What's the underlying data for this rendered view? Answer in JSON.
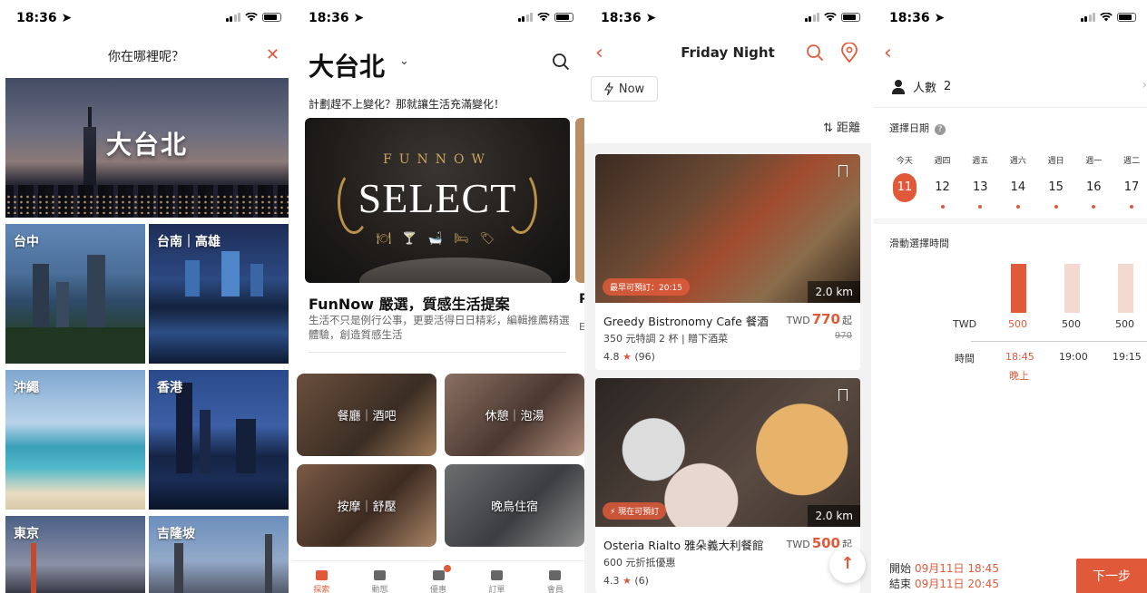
{
  "status": {
    "time": "18:36 ➤"
  },
  "screen1": {
    "title": "你在哪裡呢？",
    "close": "✕",
    "main_city": "大台北",
    "cities": [
      "台中",
      "台南｜高雄",
      "沖繩",
      "香港",
      "東京",
      "吉隆坡"
    ]
  },
  "screen2": {
    "city": "大台北",
    "chevron": "⌄",
    "tagline": "計劃趕不上變化？那就讓生活充滿變化！",
    "banner": {
      "arc": "FUNNOW",
      "title": "SELECT",
      "icons": "🍽 🍸 🛁 🛏 🏷"
    },
    "heading": "FunNow 嚴選，質感生活提案",
    "desc": "生活不只是例行公事，更要活得日日精彩，編輯推薦精選體驗，創造質感生活",
    "peek_heading": "P",
    "peek_desc": "E",
    "categories": [
      "餐廳｜酒吧",
      "休憩｜泡湯",
      "按摩｜舒壓",
      "晚鳥住宿"
    ],
    "tabs": [
      "探索",
      "動態",
      "優惠",
      "訂單",
      "會員"
    ]
  },
  "screen3": {
    "back": "‹",
    "title": "Friday Night",
    "now_chip": "Now",
    "sort": "⇅ 距離",
    "cards": [
      {
        "name": "Greedy Bistronomy Cafe 餐酒",
        "currency": "TWD",
        "price": "770",
        "price_suffix": "起",
        "desc": "350 元特調 2 杯 | 贈下酒菜",
        "original": "970",
        "rating": "4.8",
        "reviews": "(96)",
        "distance": "2.0 km",
        "badge": "最早可預訂：20:15"
      },
      {
        "name": "Osteria Rialto 雅朵義大利餐館",
        "currency": "TWD",
        "price": "500",
        "price_suffix": "起",
        "desc": "600 元折抵優惠",
        "original": "",
        "rating": "4.3",
        "reviews": "(6)",
        "distance": "2.0 km",
        "badge": "⚡ 現在可預訂"
      }
    ],
    "fab": "↑"
  },
  "screen4": {
    "back": "‹",
    "people_label": "人數",
    "people_count": "2",
    "arrow": "›",
    "date_label": "選擇日期",
    "help": "?",
    "days": [
      {
        "wd": "今天",
        "dn": "11"
      },
      {
        "wd": "週四",
        "dn": "12"
      },
      {
        "wd": "週五",
        "dn": "13"
      },
      {
        "wd": "週六",
        "dn": "14"
      },
      {
        "wd": "週日",
        "dn": "15"
      },
      {
        "wd": "週一",
        "dn": "16"
      },
      {
        "wd": "週二",
        "dn": "17"
      }
    ],
    "time_label": "滑動選擇時間",
    "twd": "TWD",
    "prices": [
      "500",
      "500",
      "500"
    ],
    "time_row": "時間",
    "times": [
      "18:45",
      "19:00",
      "19:15"
    ],
    "period": "晚上",
    "start_label": "開始",
    "start_value": "09月11日 18:45",
    "end_label": "結束",
    "end_value": "09月11日 20:45",
    "next": "下一步"
  },
  "colors": {
    "accent": "#e05a3a",
    "accent_light": "#f3d9cf"
  }
}
